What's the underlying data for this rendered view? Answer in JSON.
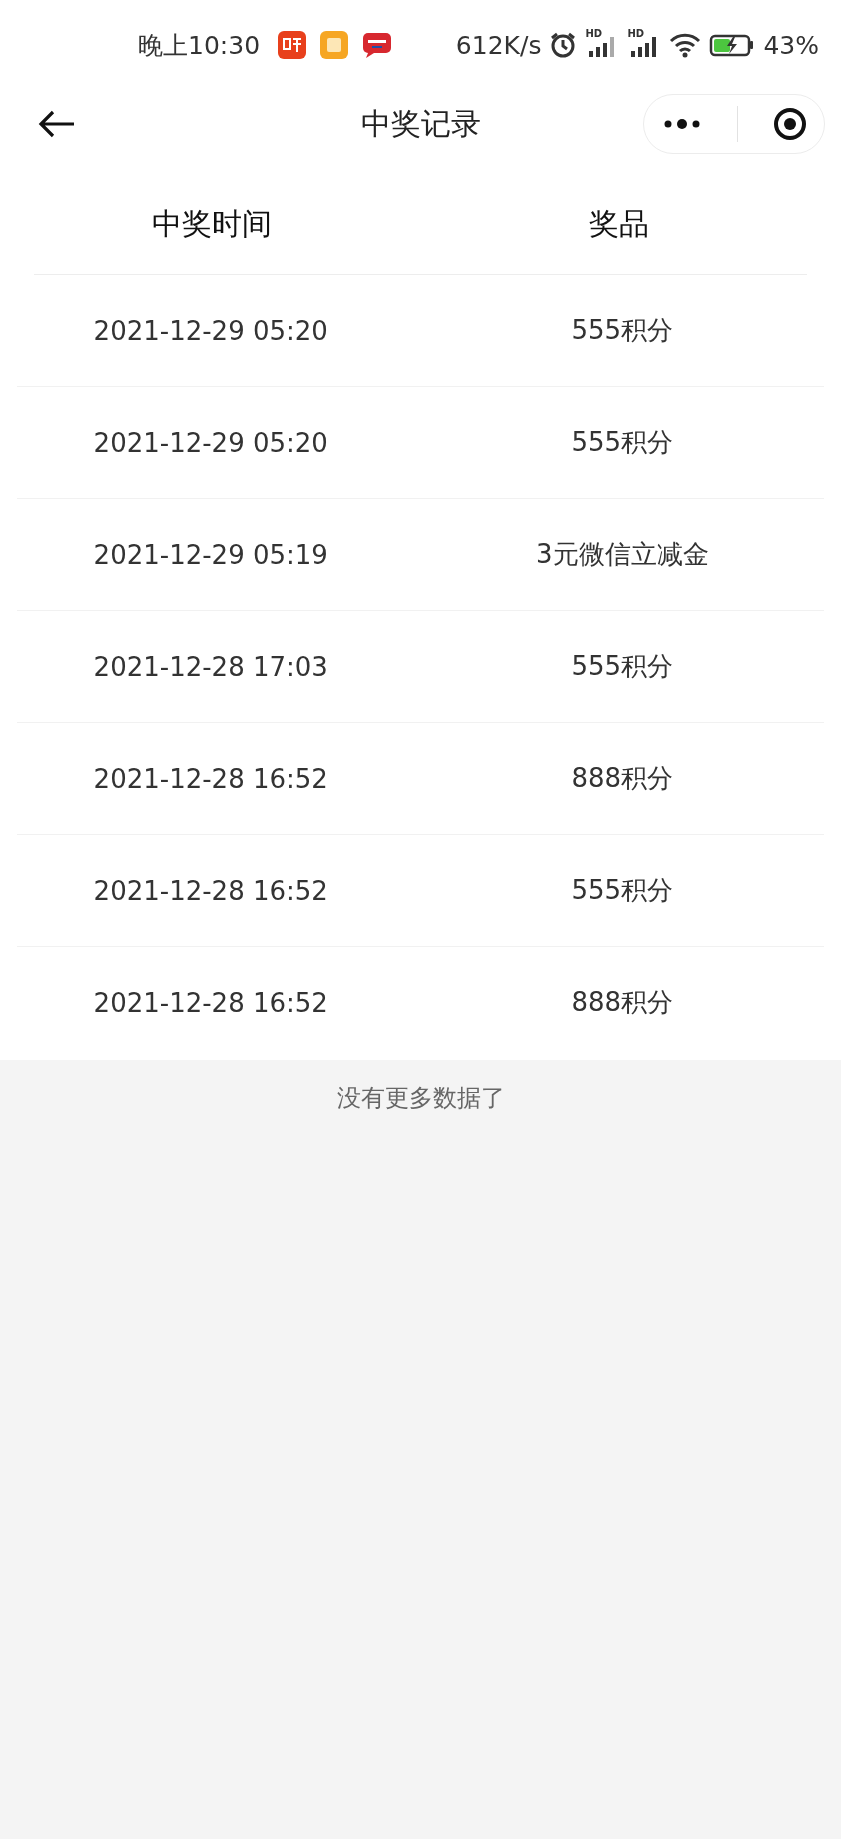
{
  "status_bar": {
    "time": "晚上10:30",
    "network_speed": "612K/s",
    "battery": "43%",
    "signals": [
      {
        "label": "HD"
      },
      {
        "label": "HD"
      }
    ]
  },
  "nav_bar": {
    "title": "中奖记录"
  },
  "table": {
    "columns": [
      "中奖时间",
      "奖品"
    ],
    "rows": [
      {
        "time": "2021-12-29 05:20",
        "prize": "555积分"
      },
      {
        "time": "2021-12-29 05:20",
        "prize": "555积分"
      },
      {
        "time": "2021-12-29 05:19",
        "prize": "3元微信立减金"
      },
      {
        "time": "2021-12-28 17:03",
        "prize": "555积分"
      },
      {
        "time": "2021-12-28 16:52",
        "prize": "888积分"
      },
      {
        "time": "2021-12-28 16:52",
        "prize": "555积分"
      },
      {
        "time": "2021-12-28 16:52",
        "prize": "888积分"
      }
    ]
  },
  "footer_note": "没有更多数据了"
}
